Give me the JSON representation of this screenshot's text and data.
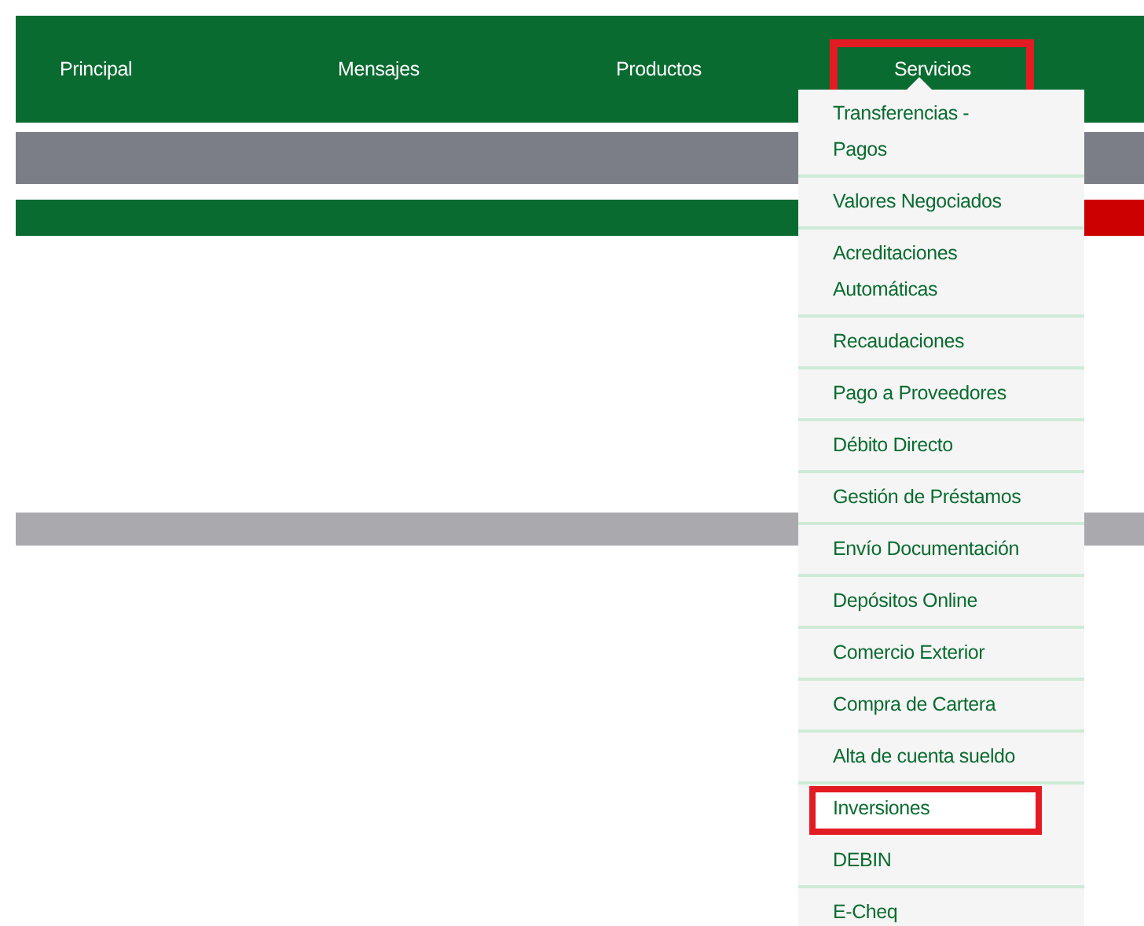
{
  "nav": [
    {
      "label": "Principal",
      "highlighted": false
    },
    {
      "label": "Mensajes",
      "highlighted": false
    },
    {
      "label": "Productos",
      "highlighted": false
    },
    {
      "label": "Servicios",
      "highlighted": true
    }
  ],
  "dropdown": {
    "items": [
      {
        "label": "Transferencias - Pagos",
        "highlighted": false
      },
      {
        "label": "Valores Negociados",
        "highlighted": false
      },
      {
        "label": "Acreditaciones Automáticas",
        "highlighted": false
      },
      {
        "label": "Recaudaciones",
        "highlighted": false
      },
      {
        "label": "Pago a Proveedores",
        "highlighted": false
      },
      {
        "label": "Débito Directo",
        "highlighted": false
      },
      {
        "label": "Gestión de Préstamos",
        "highlighted": false
      },
      {
        "label": "Envío Documentación",
        "highlighted": false
      },
      {
        "label": "Depósitos Online",
        "highlighted": false
      },
      {
        "label": "Comercio Exterior",
        "highlighted": false
      },
      {
        "label": "Compra de Cartera",
        "highlighted": false
      },
      {
        "label": "Alta de cuenta sueldo",
        "highlighted": false
      },
      {
        "label": "Inversiones",
        "highlighted": true
      },
      {
        "label": "DEBIN",
        "highlighted": false
      },
      {
        "label": "E-Cheq",
        "highlighted": false
      }
    ]
  }
}
